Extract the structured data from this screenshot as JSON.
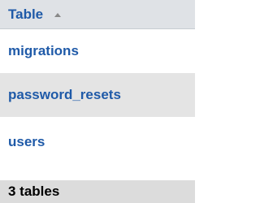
{
  "header": {
    "column_label": "Table",
    "sort_icon": "sort-ascending-icon"
  },
  "rows": [
    {
      "name": "migrations"
    },
    {
      "name": "password_resets"
    },
    {
      "name": "users"
    }
  ],
  "footer": {
    "summary": "3 tables"
  },
  "colors": {
    "link": "#1f5aa8",
    "header_bg": "#dfe2e6",
    "alt_row_bg": "#e4e4e4",
    "footer_bg": "#dcdcdc"
  }
}
